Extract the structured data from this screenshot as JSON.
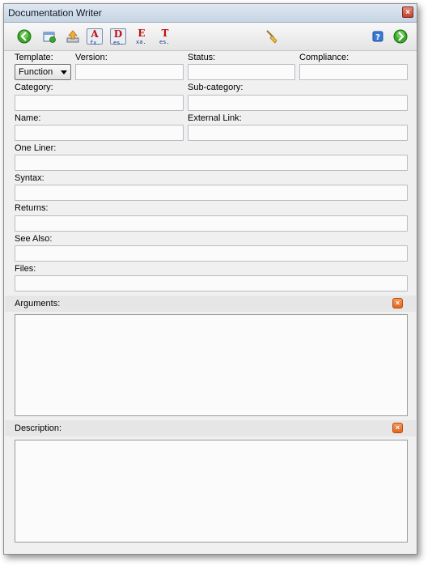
{
  "window": {
    "title": "Documentation Writer",
    "close_glyph": "×"
  },
  "toolbar": {
    "buttons": [
      {
        "name": "back-button",
        "icon": "green-left-arrow-icon"
      },
      {
        "name": "new-doc-button",
        "icon": "new-document-icon"
      },
      {
        "name": "upload-button",
        "icon": "upload-icon"
      },
      {
        "name": "format-a-button",
        "glyph": "A",
        "sub": "fx."
      },
      {
        "name": "format-d-button",
        "glyph": "D",
        "sub": "es."
      },
      {
        "name": "format-e-button",
        "glyph": "E",
        "sub": "xa."
      },
      {
        "name": "format-t-button",
        "glyph": "T",
        "sub": "es."
      },
      {
        "name": "clean-button",
        "icon": "broom-icon"
      },
      {
        "name": "help-button",
        "icon": "help-icon"
      },
      {
        "name": "forward-button",
        "icon": "green-right-arrow-icon"
      }
    ]
  },
  "form": {
    "template_label": "Template:",
    "template_value": "Function",
    "version_label": "Version:",
    "status_label": "Status:",
    "compliance_label": "Compliance:",
    "category_label": "Category:",
    "subcategory_label": "Sub-category:",
    "name_label": "Name:",
    "external_link_label": "External Link:",
    "one_liner_label": "One Liner:",
    "syntax_label": "Syntax:",
    "returns_label": "Returns:",
    "see_also_label": "See Also:",
    "files_label": "Files:",
    "arguments_label": "Arguments:",
    "description_label": "Description:",
    "clear_glyph": "×"
  },
  "colors": {
    "accent_orange": "#e0661e",
    "arrow_green": "#3aa82a"
  }
}
